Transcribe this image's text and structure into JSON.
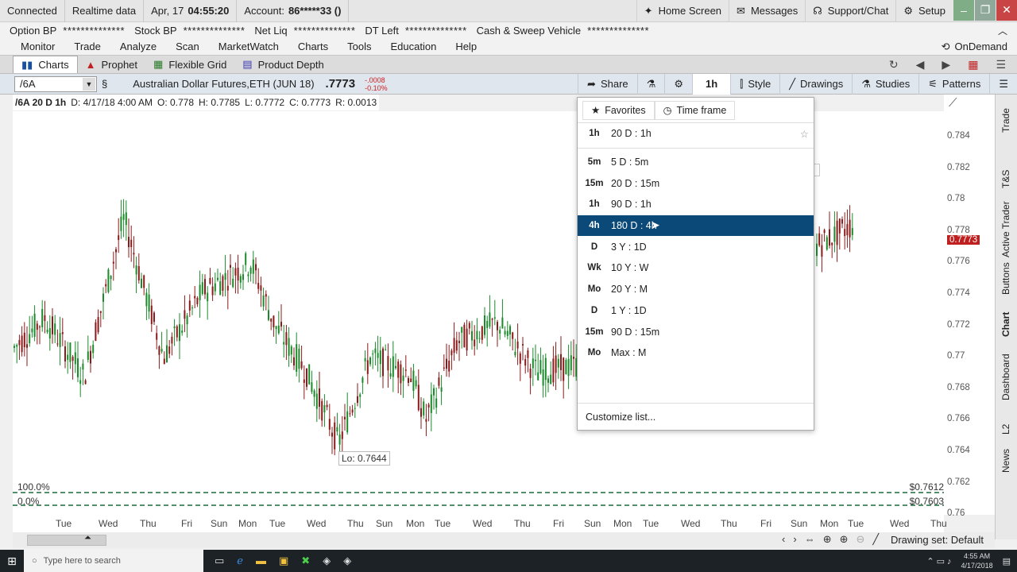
{
  "status": {
    "connection": "Connected",
    "data_mode": "Realtime data",
    "date": "Apr, 17",
    "time": "04:55:20",
    "account_label": "Account:",
    "account_value": "86*****33 ()",
    "home_screen": "Home Screen",
    "messages": "Messages",
    "support": "Support/Chat",
    "setup": "Setup"
  },
  "account_bar": {
    "items": [
      {
        "label": "Option BP",
        "value": "**************"
      },
      {
        "label": "Stock BP",
        "value": "**************"
      },
      {
        "label": "Net Liq",
        "value": "**************"
      },
      {
        "label": "DT Left",
        "value": "**************"
      },
      {
        "label": "Cash & Sweep Vehicle",
        "value": "**************"
      }
    ]
  },
  "menu": {
    "items": [
      "Monitor",
      "Trade",
      "Analyze",
      "Scan",
      "MarketWatch",
      "Charts",
      "Tools",
      "Education",
      "Help"
    ],
    "ondemand": "OnDemand"
  },
  "chart_tabs": [
    "Charts",
    "Prophet",
    "Flexible Grid",
    "Product Depth"
  ],
  "symbol_bar": {
    "symbol": "/6A",
    "description": "Australian Dollar Futures,ETH (JUN 18)",
    "last_price": ".7773",
    "change": "-.0008",
    "change_pct": "-0.10%",
    "share": "Share",
    "timeframe": "1h",
    "style": "Style",
    "drawings": "Drawings",
    "studies": "Studies",
    "patterns": "Patterns"
  },
  "info_line": {
    "symbol_tf": "/6A 20 D 1h",
    "date": "D: 4/17/18 4:00 AM",
    "open": "O: 0.778",
    "high": "H: 0.7785",
    "low": "L: 0.7772",
    "close": "C: 0.7773",
    "range": "R: 0.0013"
  },
  "chart": {
    "low_label": "Lo: 0.7644",
    "pct_top": "100.0%",
    "pct_bottom": "0.0%",
    "level_top": "$0.7612",
    "level_bottom": "$0.7603",
    "last_price_tag": "0.7773",
    "price_ticks": [
      "0.784",
      "0.782",
      "0.78",
      "0.778",
      "0.776",
      "0.774",
      "0.772",
      "0.77",
      "0.768",
      "0.766",
      "0.764",
      "0.762",
      "0.76"
    ],
    "time_ticks": [
      "Tue",
      "Wed",
      "Thu",
      "Fri",
      "Sun",
      "Mon",
      "Tue",
      "Wed",
      "Thu",
      "Sun",
      "Mon",
      "Tue",
      "Wed",
      "Thu",
      "Fri",
      "Sun",
      "Mon",
      "Tue",
      "Wed",
      "Thu",
      "Fri",
      "Sun",
      "Mon",
      "Tue",
      "Wed",
      "Thu"
    ],
    "colors": {
      "up": "#1a8a2a",
      "down": "#8b1a1a",
      "selected": "#0b4a78",
      "last_price": "#c01f1f"
    }
  },
  "right_tabs": [
    "Trade",
    "T&S",
    "Active Trader",
    "Buttons",
    "Chart",
    "Dashboard",
    "L2",
    "News"
  ],
  "timeframe_menu": {
    "tabs": [
      "Favorites",
      "Time frame"
    ],
    "current": {
      "abbr": "1h",
      "label": "20 D : 1h"
    },
    "items": [
      {
        "abbr": "5m",
        "label": "5 D : 5m"
      },
      {
        "abbr": "15m",
        "label": "20 D : 15m"
      },
      {
        "abbr": "1h",
        "label": "90 D : 1h"
      },
      {
        "abbr": "4h",
        "label": "180 D : 4h"
      },
      {
        "abbr": "D",
        "label": "3 Y : 1D"
      },
      {
        "abbr": "Wk",
        "label": "10 Y : W"
      },
      {
        "abbr": "Mo",
        "label": "20 Y : M"
      },
      {
        "abbr": "D",
        "label": "1 Y : 1D"
      },
      {
        "abbr": "15m",
        "label": "90 D : 15m"
      },
      {
        "abbr": "Mo",
        "label": "Max : M"
      }
    ],
    "selected_index": 3,
    "customize": "Customize list..."
  },
  "bottom": {
    "drawing_set": "Drawing set: Default"
  },
  "taskbar": {
    "search_placeholder": "Type here to search",
    "time": "4:55 AM",
    "date": "4/17/2018"
  }
}
